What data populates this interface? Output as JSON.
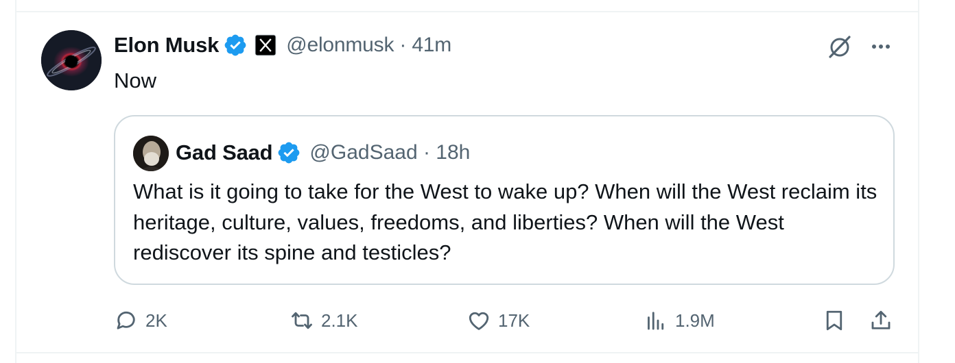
{
  "tweet": {
    "author_name": "Elon Musk",
    "handle_time": "@elonmusk · 41m",
    "text": "Now"
  },
  "quote": {
    "author_name": "Gad Saad",
    "handle_time": "@GadSaad · 18h",
    "text": "What is it going to take for the West to wake up?  When will the West reclaim its heritage, culture, values, freedoms, and liberties?  When will the West rediscover its spine and testicles?"
  },
  "actions": {
    "replies": "2K",
    "reposts": "2.1K",
    "likes": "17K",
    "views": "1.9M"
  },
  "icons": {
    "verified": "verified-badge-icon",
    "affiliate": "x-logo-icon",
    "grok": "grok-icon",
    "more": "more-icon",
    "reply": "reply-icon",
    "repost": "repost-icon",
    "like": "heart-icon",
    "views": "views-icon",
    "bookmark": "bookmark-icon",
    "share": "share-icon"
  },
  "colors": {
    "verified": "#1d9bf0",
    "text": "#0f1419",
    "secondary": "#536471",
    "border": "#cfd9de"
  }
}
